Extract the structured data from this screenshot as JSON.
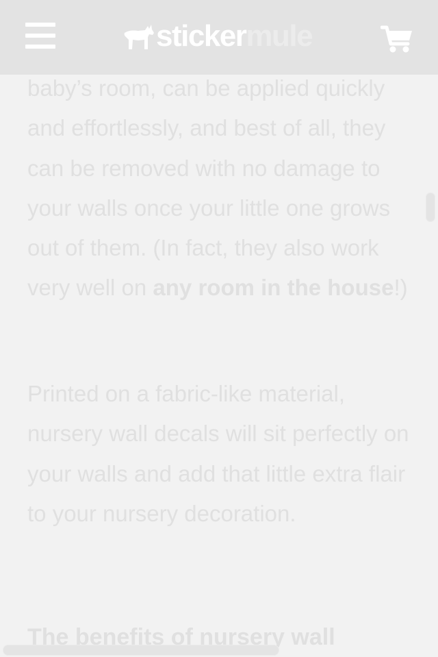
{
  "header": {
    "logo_text_a": "sticker",
    "logo_text_b": "mule"
  },
  "article": {
    "para1": {
      "text": "baby’s room, can be applied quickly and effortlessly, and best of all, they can be removed with no damage to your walls once your little one grows out of them. (In fact, they also work very well on ",
      "link": "any room in the house",
      "after": "!)"
    },
    "para2": "Printed on a fabric-like material, nursery wall decals will sit perfectly on your walls and add that little extra flair to your nursery decoration.",
    "heading": "The benefits of nursery wall decals vs. paint"
  },
  "icons": {
    "menu": "hamburger-menu-icon",
    "logo": "mule-logo-icon",
    "cart": "shopping-cart-icon"
  },
  "colors": {
    "topbar": "#e3e3e3",
    "background": "#f2f2f2",
    "text": "#e0e0e0"
  }
}
